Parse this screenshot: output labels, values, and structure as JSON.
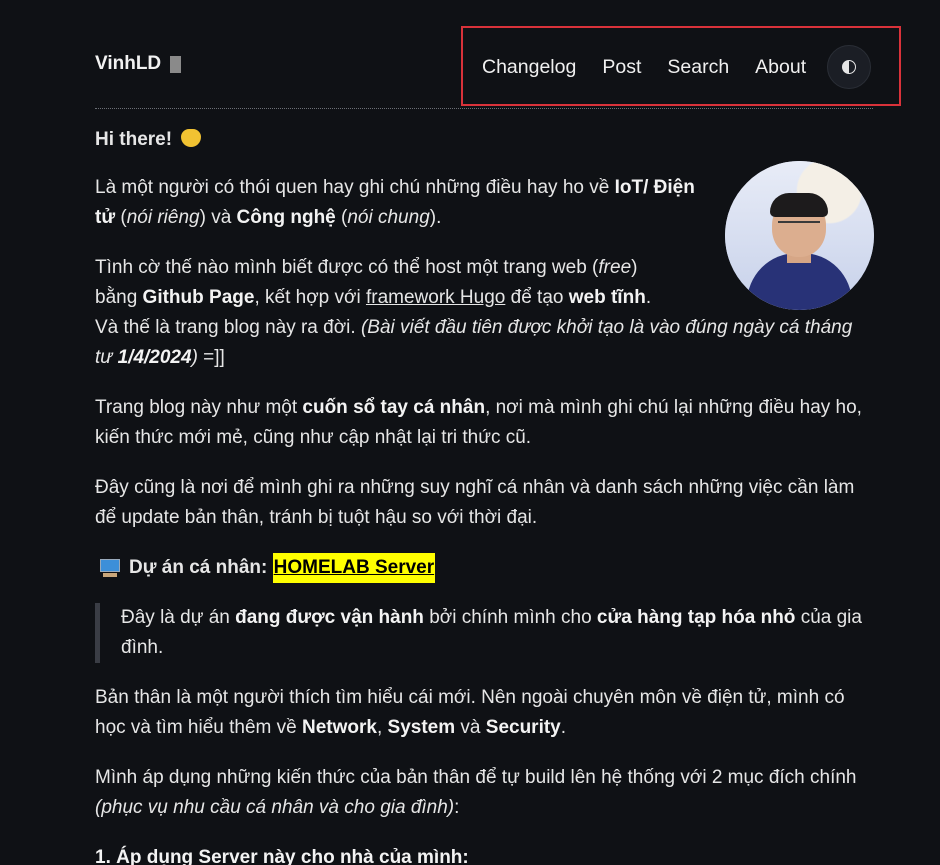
{
  "site": {
    "logo_text": "VinhLD"
  },
  "nav": {
    "items": [
      "Changelog",
      "Post",
      "Search",
      "About"
    ],
    "theme_toggle_icon": "half-circle-icon"
  },
  "content": {
    "greeting": "Hi there!",
    "p1": {
      "t1": "Là một người có thói quen hay ghi chú những điều hay ho về ",
      "b1": "IoT/ Điện tử",
      "t2": " (",
      "i1": "nói riêng",
      "t3": ") và ",
      "b2": "Công nghệ",
      "t4": " (",
      "i2": "nói chung",
      "t5": ")."
    },
    "p2": {
      "t1": "Tình cờ thế nào mình biết được có thể host một trang web (",
      "i1": "free",
      "t2": ") bằng ",
      "b1": "Github Page",
      "t3": ", kết hợp với ",
      "link": "framework Hugo",
      "t4": " để tạo ",
      "b2": "web tĩnh",
      "t5": ".",
      "t6": "Và thế là trang blog này ra đời. ",
      "i2": "(Bài viết đầu tiên được khởi tạo là vào đúng ngày cá tháng tư ",
      "bi": "1/4/2024",
      "i3": ")",
      "t7": " =]]"
    },
    "p3": {
      "t1": "Trang blog này như một ",
      "b1": "cuốn sổ tay cá nhân",
      "t2": ", nơi mà mình ghi chú lại những điều hay ho, kiến thức mới mẻ, cũng như cập nhật lại tri thức cũ."
    },
    "p4": "Đây cũng là nơi để mình ghi ra những suy nghĩ cá nhân và danh sách những việc cần làm để update bản thân, tránh bị tuột hậu so với thời đại.",
    "project": {
      "label": "Dự án cá nhân: ",
      "link": "HOMELAB Server"
    },
    "quote": {
      "t1": "Đây là dự án ",
      "b1": "đang được vận hành",
      "t2": " bởi chính mình cho ",
      "b2": "cửa hàng tạp hóa nhỏ",
      "t3": " của gia đình."
    },
    "p5": {
      "t1": "Bản thân là một người thích tìm hiểu cái mới. Nên ngoài chuyên môn về điện tử, mình có học và tìm hiểu thêm về ",
      "b1": "Network",
      "t2": ", ",
      "b2": "System",
      "t3": " và ",
      "b3": "Security",
      "t4": "."
    },
    "p6": {
      "t1": "Mình áp dụng những kiến thức của bản thân để tự build lên hệ thống với 2 mục đích chính ",
      "i1": "(phục vụ nhu cầu cá nhân và cho gia đình)",
      "t2": ":"
    },
    "list_item_1": "1. Áp dụng Server này cho nhà của mình:"
  },
  "colors": {
    "background": "#0f1115",
    "highlight": "#ffff00",
    "nav_box_border": "#d9323a"
  }
}
